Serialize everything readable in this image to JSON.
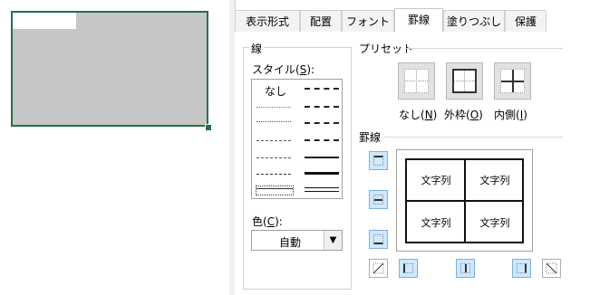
{
  "tabs": [
    {
      "label": "表示形式",
      "active": false
    },
    {
      "label": "配置",
      "active": false
    },
    {
      "label": "フォント",
      "active": false
    },
    {
      "label": "罫線",
      "active": true
    },
    {
      "label": "塗りつぶし",
      "active": false
    },
    {
      "label": "保護",
      "active": false
    }
  ],
  "line": {
    "section_title": "線",
    "style_label": "スタイル(",
    "style_key": "S",
    "style_suffix": "):",
    "none_label": "なし",
    "color_label": "色(",
    "color_key": "C",
    "color_suffix": "):",
    "color_value": "自動"
  },
  "presets": {
    "section_title": "プリセット",
    "none_label": "なし(",
    "none_key": "N",
    "outline_label": "外枠(",
    "outline_key": "O",
    "inside_label": "内側(",
    "inside_key": "I",
    "close": ")"
  },
  "border": {
    "section_title": "罫線",
    "cells": [
      "文字列",
      "文字列",
      "文字列",
      "文字列"
    ]
  },
  "colors": {
    "selection": "#217346",
    "cell_fill": "#c6c6c6",
    "highlight": "#cde8ff"
  }
}
